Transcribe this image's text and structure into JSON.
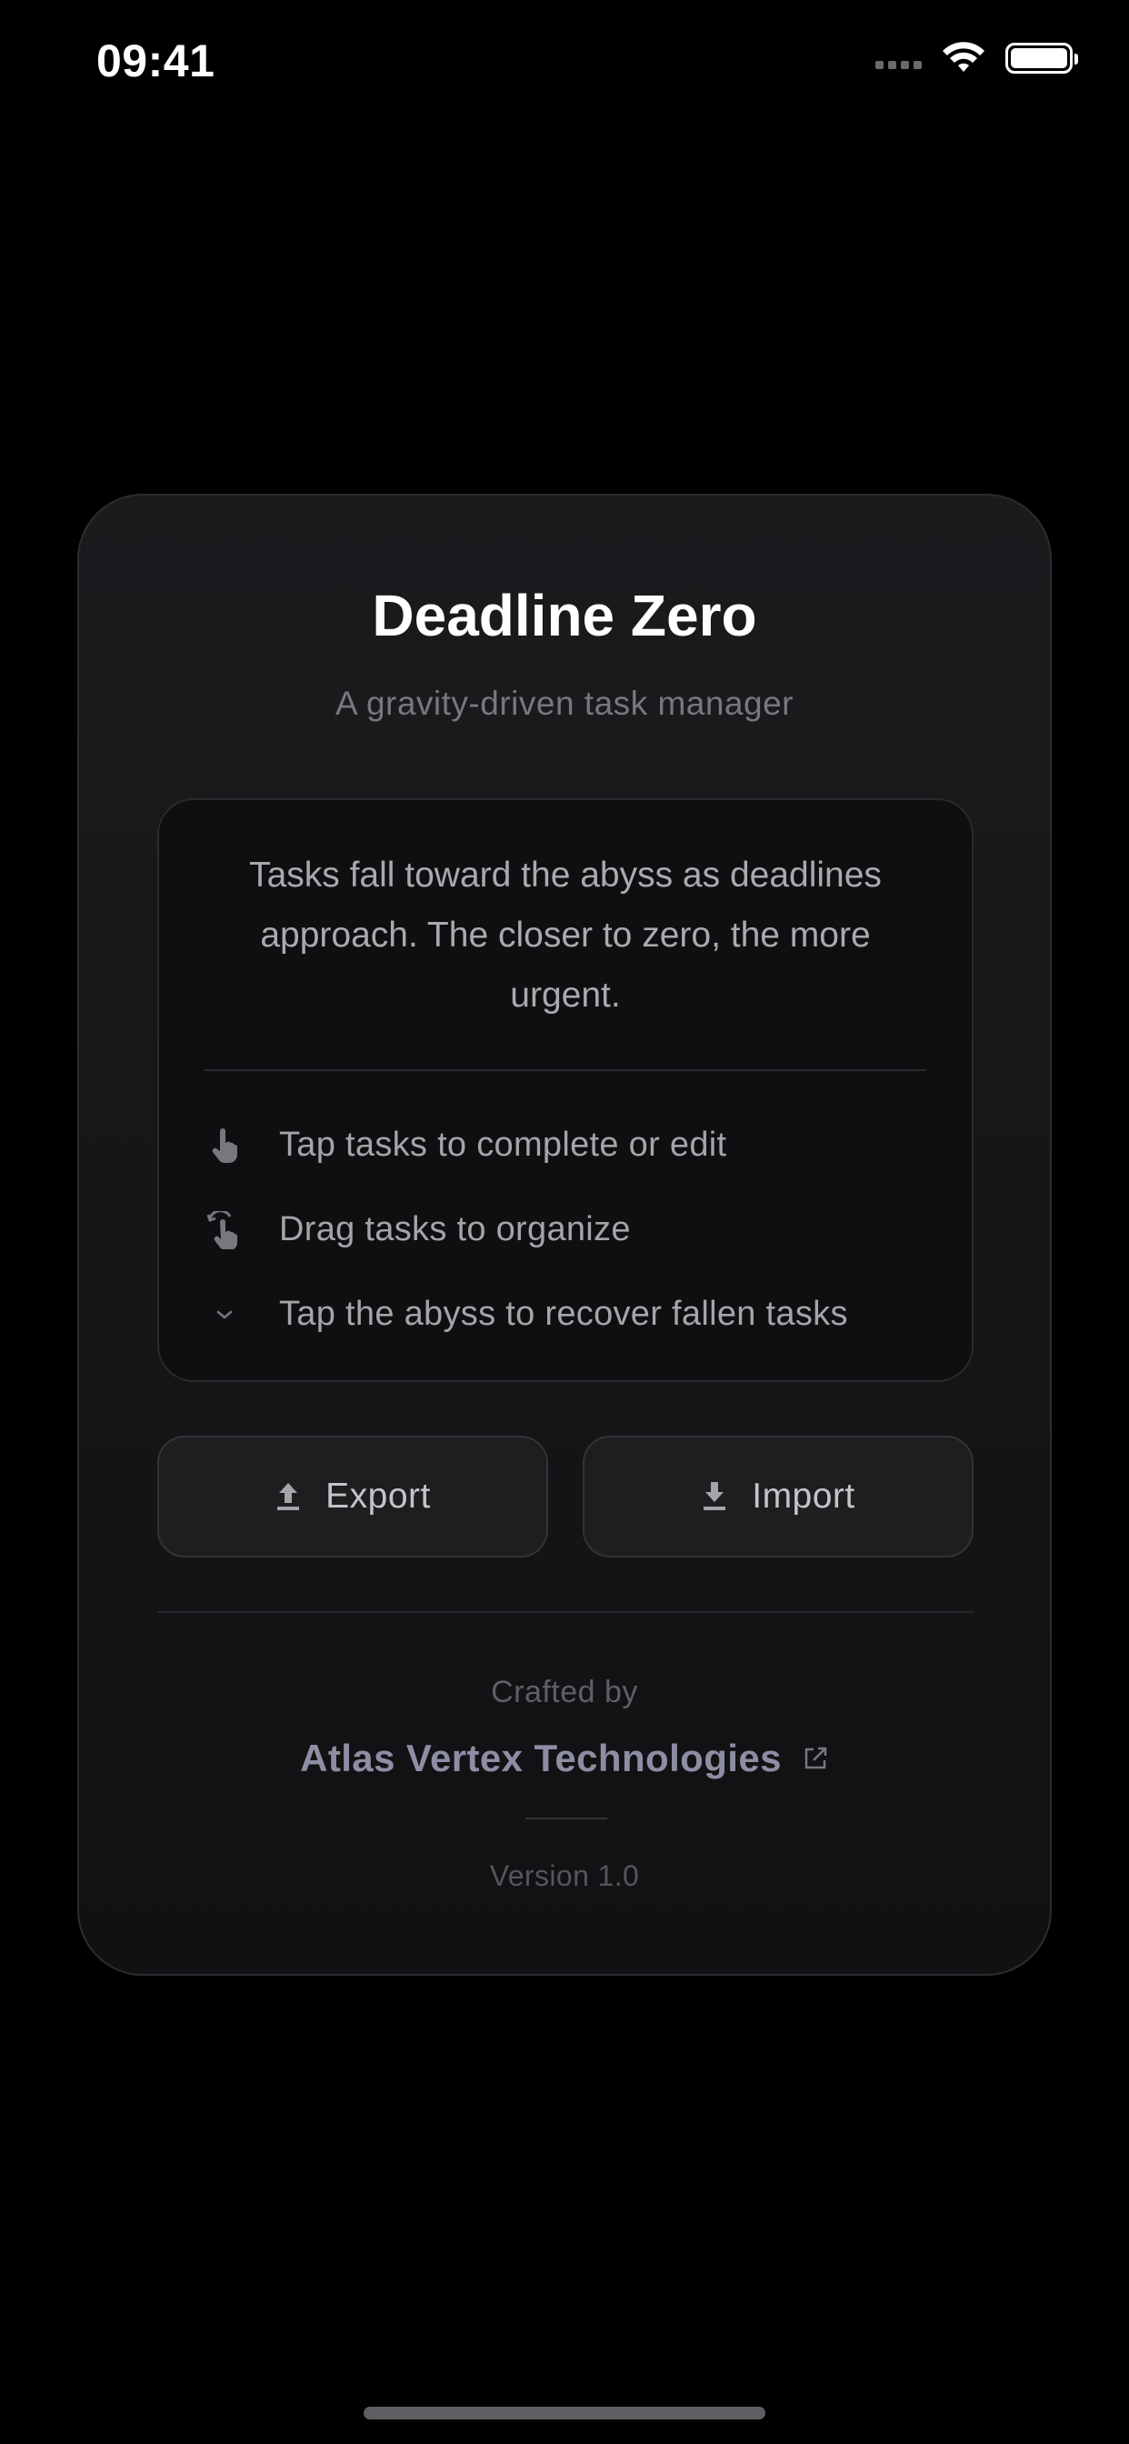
{
  "status_bar": {
    "time": "09:41",
    "icons": [
      "signal-icon",
      "wifi-icon",
      "battery-icon"
    ]
  },
  "app": {
    "title": "Deadline Zero",
    "subtitle": "A gravity-driven task manager"
  },
  "info": {
    "description": "Tasks fall toward the abyss as deadlines approach. The closer to zero, the more urgent.",
    "tips": [
      {
        "icon": "tap-hand-icon",
        "label": "Tap tasks to complete or edit"
      },
      {
        "icon": "drag-hand-icon",
        "label": "Drag tasks to organize"
      },
      {
        "icon": "chevron-down-icon",
        "label": "Tap the abyss to recover fallen tasks"
      }
    ]
  },
  "actions": {
    "export_label": "Export",
    "export_icon": "upload-icon",
    "import_label": "Import",
    "import_icon": "download-icon"
  },
  "footer": {
    "crafted_by": "Crafted by",
    "company": "Atlas Vertex Technologies",
    "company_icon": "external-link-icon",
    "version": "Version 1.0"
  },
  "colors": {
    "background": "#000000",
    "card": "#18181b",
    "text_muted": "#a4a4a9",
    "link": "#8d8da4"
  }
}
